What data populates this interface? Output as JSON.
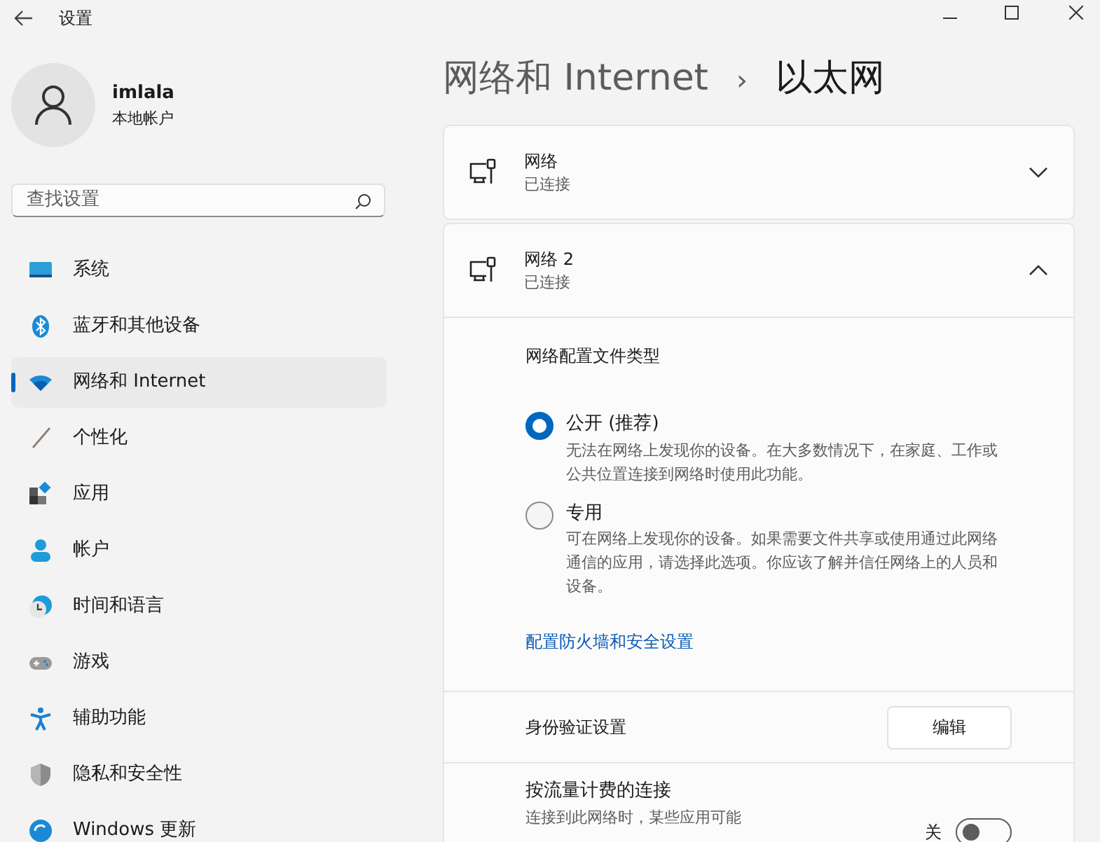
{
  "window": {
    "title": "设置"
  },
  "user": {
    "name": "imlala",
    "account_type": "本地帐户"
  },
  "search": {
    "placeholder": "查找设置"
  },
  "nav": [
    {
      "label": "系统",
      "selected": false
    },
    {
      "label": "蓝牙和其他设备",
      "selected": false
    },
    {
      "label": "网络和 Internet",
      "selected": true
    },
    {
      "label": "个性化",
      "selected": false
    },
    {
      "label": "应用",
      "selected": false
    },
    {
      "label": "帐户",
      "selected": false
    },
    {
      "label": "时间和语言",
      "selected": false
    },
    {
      "label": "游戏",
      "selected": false
    },
    {
      "label": "辅助功能",
      "selected": false
    },
    {
      "label": "隐私和安全性",
      "selected": false
    },
    {
      "label": "Windows 更新",
      "selected": false
    }
  ],
  "breadcrumb": {
    "parent": "网络和 Internet",
    "separator": "›",
    "current": "以太网"
  },
  "networks": [
    {
      "name": "网络",
      "status": "已连接",
      "expanded": false
    },
    {
      "name": "网络 2",
      "status": "已连接",
      "expanded": true
    }
  ],
  "profile": {
    "title": "网络配置文件类型",
    "options": [
      {
        "label": "公开 (推荐)",
        "description": "无法在网络上发现你的设备。在大多数情况下，在家庭、工作或公共位置连接到网络时使用此功能。",
        "selected": true
      },
      {
        "label": "专用",
        "description": "可在网络上发现你的设备。如果需要文件共享或使用通过此网络通信的应用，请选择此选项。你应该了解并信任网络上的人员和设备。",
        "selected": false
      }
    ],
    "link": "配置防火墙和安全设置"
  },
  "auth": {
    "label": "身份验证设置",
    "button": "编辑"
  },
  "metered": {
    "label": "按流量计费的连接",
    "description": "连接到此网络时，某些应用可能",
    "toggle_label": "关",
    "on": false
  }
}
